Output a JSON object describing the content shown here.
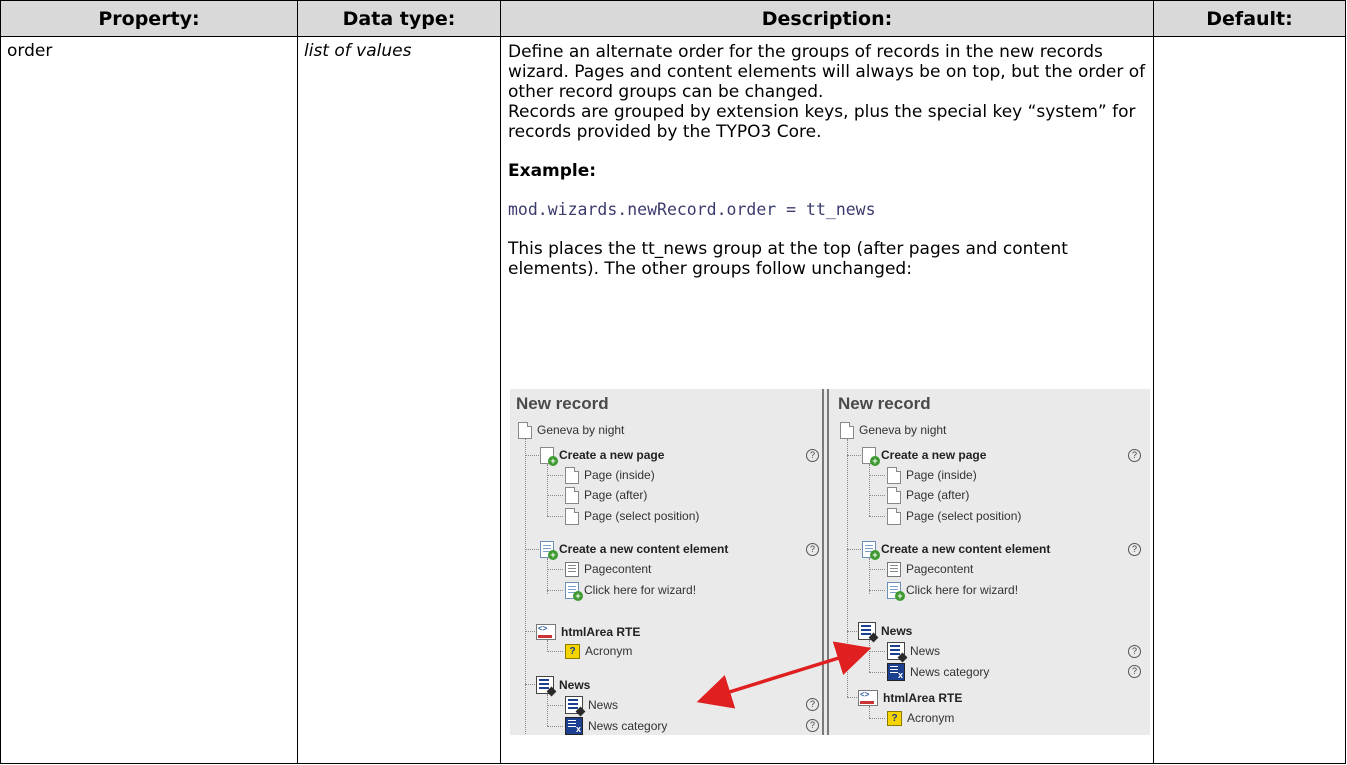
{
  "table": {
    "headers": [
      "Property:",
      "Data type:",
      "Description:",
      "Default:"
    ],
    "row": {
      "property": "order",
      "data_type": "list of values",
      "description": [
        "Define an alternate order for the groups of records in the new records wizard. Pages and content elements will always be on top, but the order of other record groups can be changed.",
        "Records are grouped by extension keys, plus the special key “system” for records provided by the TYPO3 Core."
      ],
      "example_title": "Example:",
      "code": "mod.wizards.newRecord.order = tt_news",
      "after_text": "This places the tt_news group at the top (after pages and content elements). The other groups follow unchanged:",
      "default": ""
    }
  },
  "screenshot": {
    "left": {
      "title": "New record",
      "root": "Geneva by night",
      "create_page": "Create a new page",
      "page_items": [
        "Page (inside)",
        "Page (after)",
        "Page (select position)"
      ],
      "create_content": "Create a new content element",
      "content_items": [
        "Pagecontent",
        "Click here for wizard!"
      ],
      "rte_group": "htmlArea RTE",
      "rte_items": [
        "Acronym"
      ],
      "news_group": "News",
      "news_items": [
        "News",
        "News category"
      ]
    },
    "right": {
      "title": "New record",
      "root": "Geneva by night",
      "create_page": "Create a new page",
      "page_items": [
        "Page (inside)",
        "Page (after)",
        "Page (select position)"
      ],
      "create_content": "Create a new content element",
      "content_items": [
        "Pagecontent",
        "Click here for wizard!"
      ],
      "news_group": "News",
      "news_items": [
        "News",
        "News category"
      ],
      "rte_group": "htmlArea RTE",
      "rte_items": [
        "Acronym"
      ]
    },
    "help_glyph": "?",
    "acronym_glyph": "?",
    "rte_glyph": "<>",
    "arrow_color": "#e02020"
  }
}
